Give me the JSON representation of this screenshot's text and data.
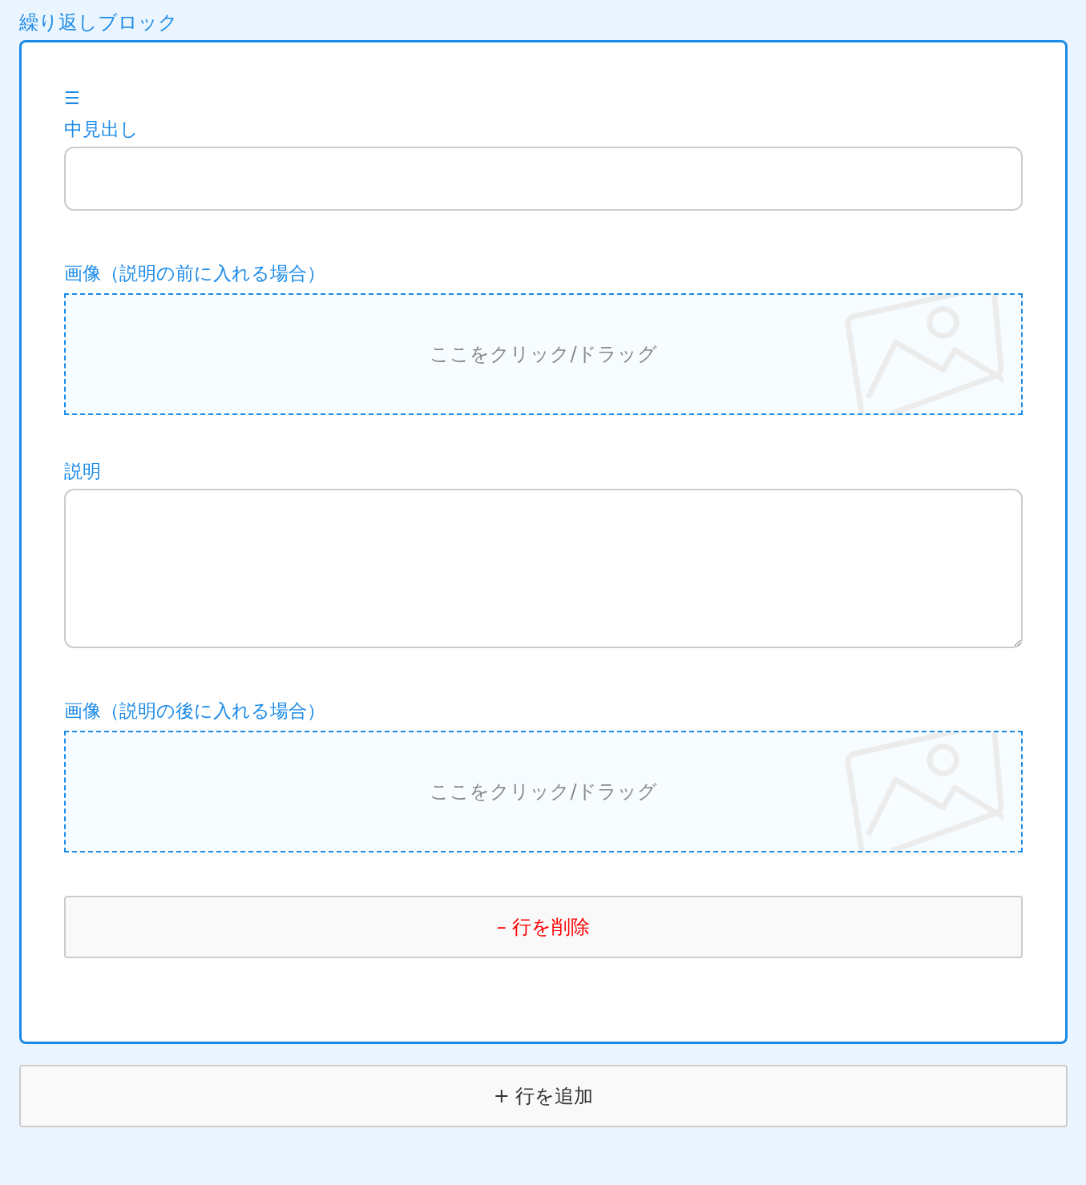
{
  "block": {
    "title": "繰り返しブロック",
    "handle": "☰",
    "fields": [
      {
        "kind": "text",
        "label": "中見出し"
      },
      {
        "kind": "image",
        "label": "画像（説明の前に入れる場合）",
        "hint": "ここをクリック/ドラッグ"
      },
      {
        "kind": "textarea",
        "label": "説明"
      },
      {
        "kind": "image",
        "label": "画像（説明の後に入れる場合）",
        "hint": "ここをクリック/ドラッグ"
      }
    ],
    "delete_button": "– 行を削除"
  },
  "add_button": "+ 行を追加"
}
